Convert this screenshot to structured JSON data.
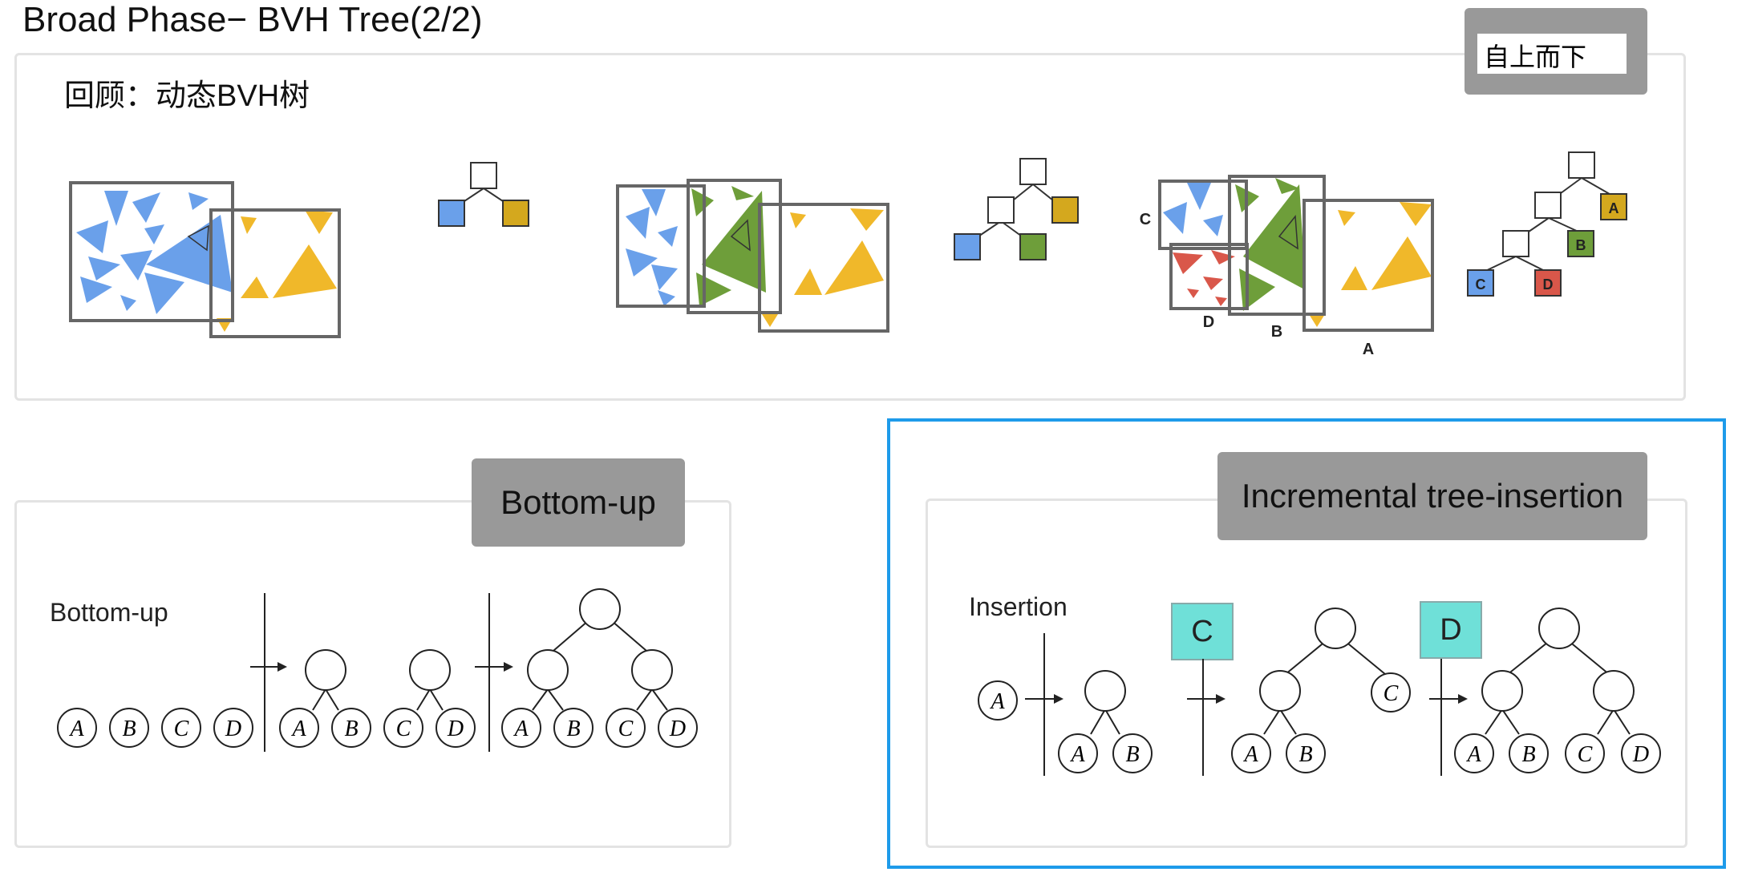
{
  "slide": {
    "title": "Broad Phase− BVH Tree(2/2)"
  },
  "top_panel": {
    "heading": "回顾：动态BVH树",
    "tag_label": "自上而下",
    "labels": {
      "a": "A",
      "b": "B",
      "c": "C",
      "d": "D"
    }
  },
  "bottom_up": {
    "tag_label": "Bottom-up",
    "figure_title": "Bottom-up",
    "leaves": [
      "A",
      "B",
      "C",
      "D"
    ]
  },
  "insertion": {
    "tag_label": "Incremental tree-insertion",
    "figure_title": "Insertion",
    "step_c_label": "C",
    "step_d_label": "D",
    "leaves": [
      "A",
      "B",
      "C",
      "D"
    ]
  },
  "colors": {
    "blue": "#6aa0ea",
    "green": "#6e9e3a",
    "yellow": "#f0b82a",
    "red": "#d9574a",
    "cyan": "#6fe0d8",
    "selection": "#1e9bea"
  }
}
